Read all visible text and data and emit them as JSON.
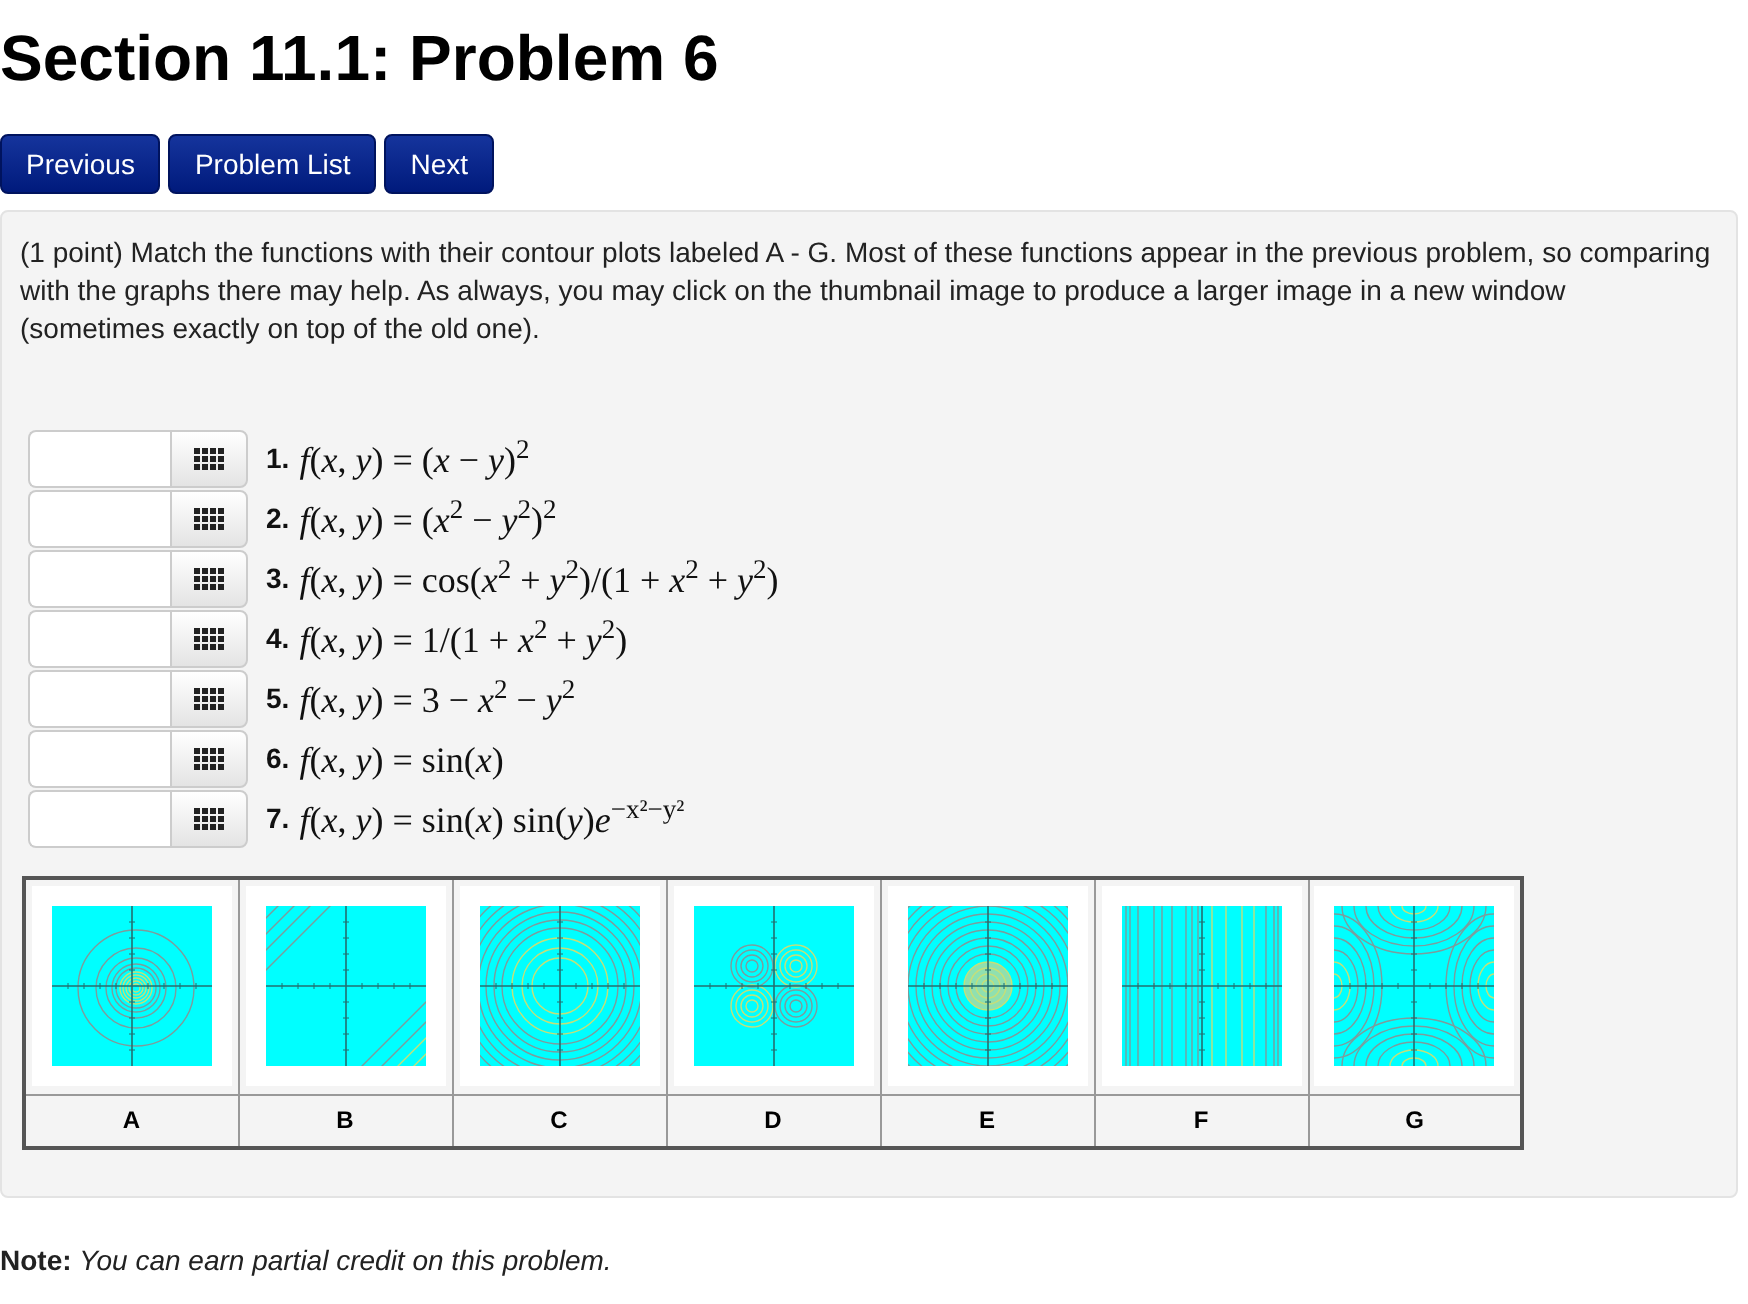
{
  "page": {
    "title": "Section 11.1: Problem 6"
  },
  "nav_buttons": [
    "Previous",
    "Problem List",
    "Next"
  ],
  "problem": {
    "intro": "(1 point) Match the functions with their contour plots labeled A - G. Most of these functions appear in the previous problem, so comparing with the graphs there may help. As always, you may click on the thumbnail image to produce a larger image in a new window (sometimes exactly on top of the old one).",
    "answers": [
      {
        "number": "1.",
        "formula": "*f*(*x*, *y*) = (*x* − *y*)$^{2}$"
      },
      {
        "number": "2.",
        "formula": "*f*(*x*, *y*) = (*x*$^{2}$ − *y*$^{2}$)$^{2}$"
      },
      {
        "number": "3.",
        "formula": "*f*(*x*, *y*) = cos(*x*$^{2}$ + *y*$^{2}$)/(1 + *x*$^{2}$ + *y*$^{2}$)"
      },
      {
        "number": "4.",
        "formula": "*f*(*x*, *y*) = 1/(1 + *x*$^{2}$ + *y*$^{2}$)"
      },
      {
        "number": "5.",
        "formula": "*f*(*x*, *y*) = 3 − *x*$^{2}$ − *y*$^{2}$"
      },
      {
        "number": "6.",
        "formula": "*f*(*x*, *y*) = sin(*x*)"
      },
      {
        "number": "7.",
        "formula": "*f*(*x*, *y*) = sin(*x*) sin(*y*)*e*$^{−x²−y²}$"
      }
    ],
    "plots": [
      {
        "label": "A",
        "kind": "peak-rings"
      },
      {
        "label": "B",
        "kind": "diagonal-lines"
      },
      {
        "label": "C",
        "kind": "wide-rings"
      },
      {
        "label": "D",
        "kind": "four-lobes"
      },
      {
        "label": "E",
        "kind": "dense-rings"
      },
      {
        "label": "F",
        "kind": "vertical-lines"
      },
      {
        "label": "G",
        "kind": "saddle"
      }
    ]
  },
  "note": {
    "text": "**Note:** *You can earn partial credit on this problem.*"
  }
}
